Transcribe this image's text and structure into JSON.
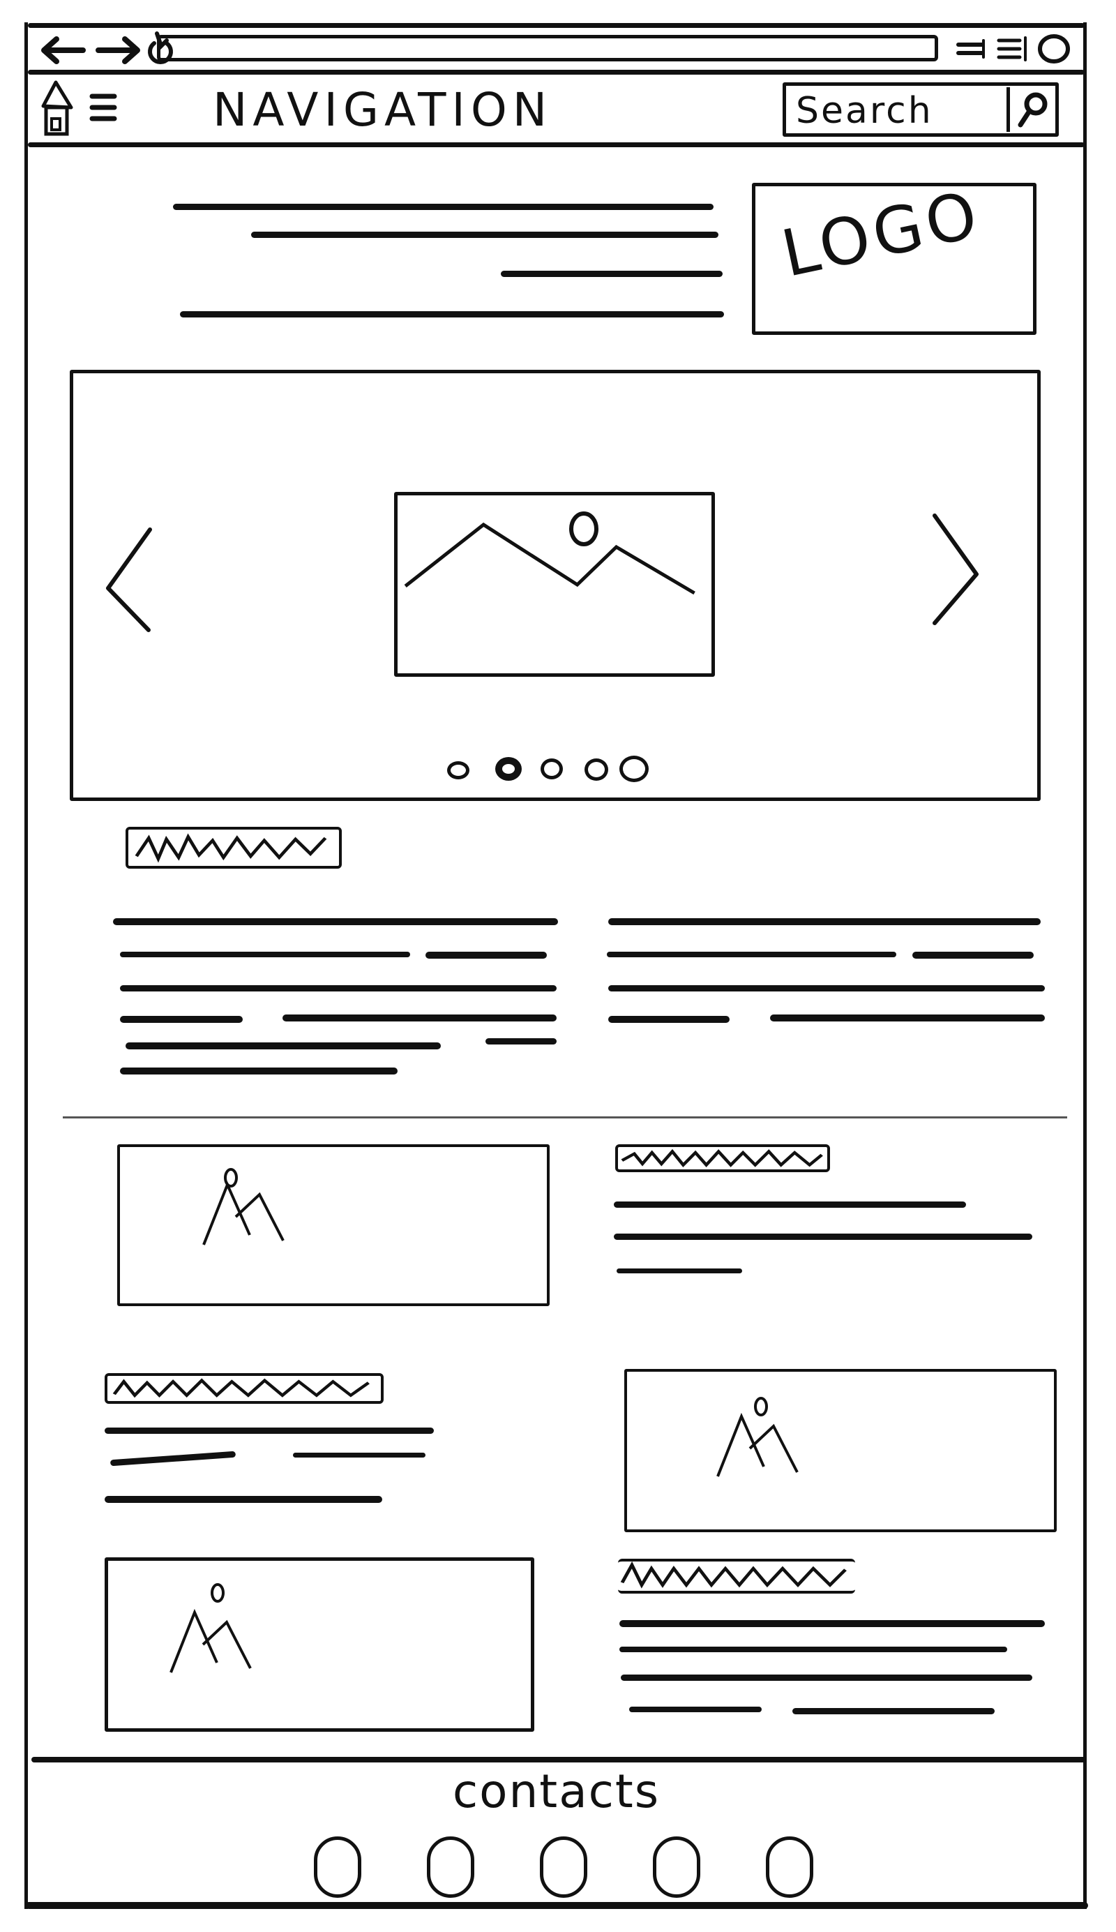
{
  "browser": {
    "back_icon": "arrow-left-icon",
    "forward_icon": "arrow-right-icon",
    "reload_icon": "reload-icon",
    "address_value": "",
    "window_controls": [
      "minimize-icon",
      "maximize-icon",
      "close-icon"
    ]
  },
  "nav": {
    "home_icon": "home-icon",
    "menu_icon": "hamburger-menu-icon",
    "title": "NAVIGATION",
    "search_placeholder": "Search",
    "search_icon": "magnifier-icon"
  },
  "hero": {
    "logo_label": "LOGO",
    "text_lines": 4
  },
  "carousel": {
    "prev_icon": "chevron-left-icon",
    "next_icon": "chevron-right-icon",
    "image_icon": "image-placeholder-icon",
    "slide_count": 5,
    "active_slide": 2
  },
  "intro": {
    "heading_placeholder": "scribbled heading",
    "columns": 2
  },
  "features": [
    {
      "image_side": "left",
      "heading_placeholder": "scribbled heading",
      "text_lines": 3
    },
    {
      "image_side": "right",
      "heading_placeholder": "scribbled heading",
      "text_lines": 3
    },
    {
      "image_side": "left",
      "heading_placeholder": "scribbled heading",
      "text_lines": 4
    }
  ],
  "footer": {
    "title": "contacts",
    "contact_icons": [
      "contact-icon-1",
      "contact-icon-2",
      "contact-icon-3",
      "contact-icon-4",
      "contact-icon-5"
    ]
  }
}
